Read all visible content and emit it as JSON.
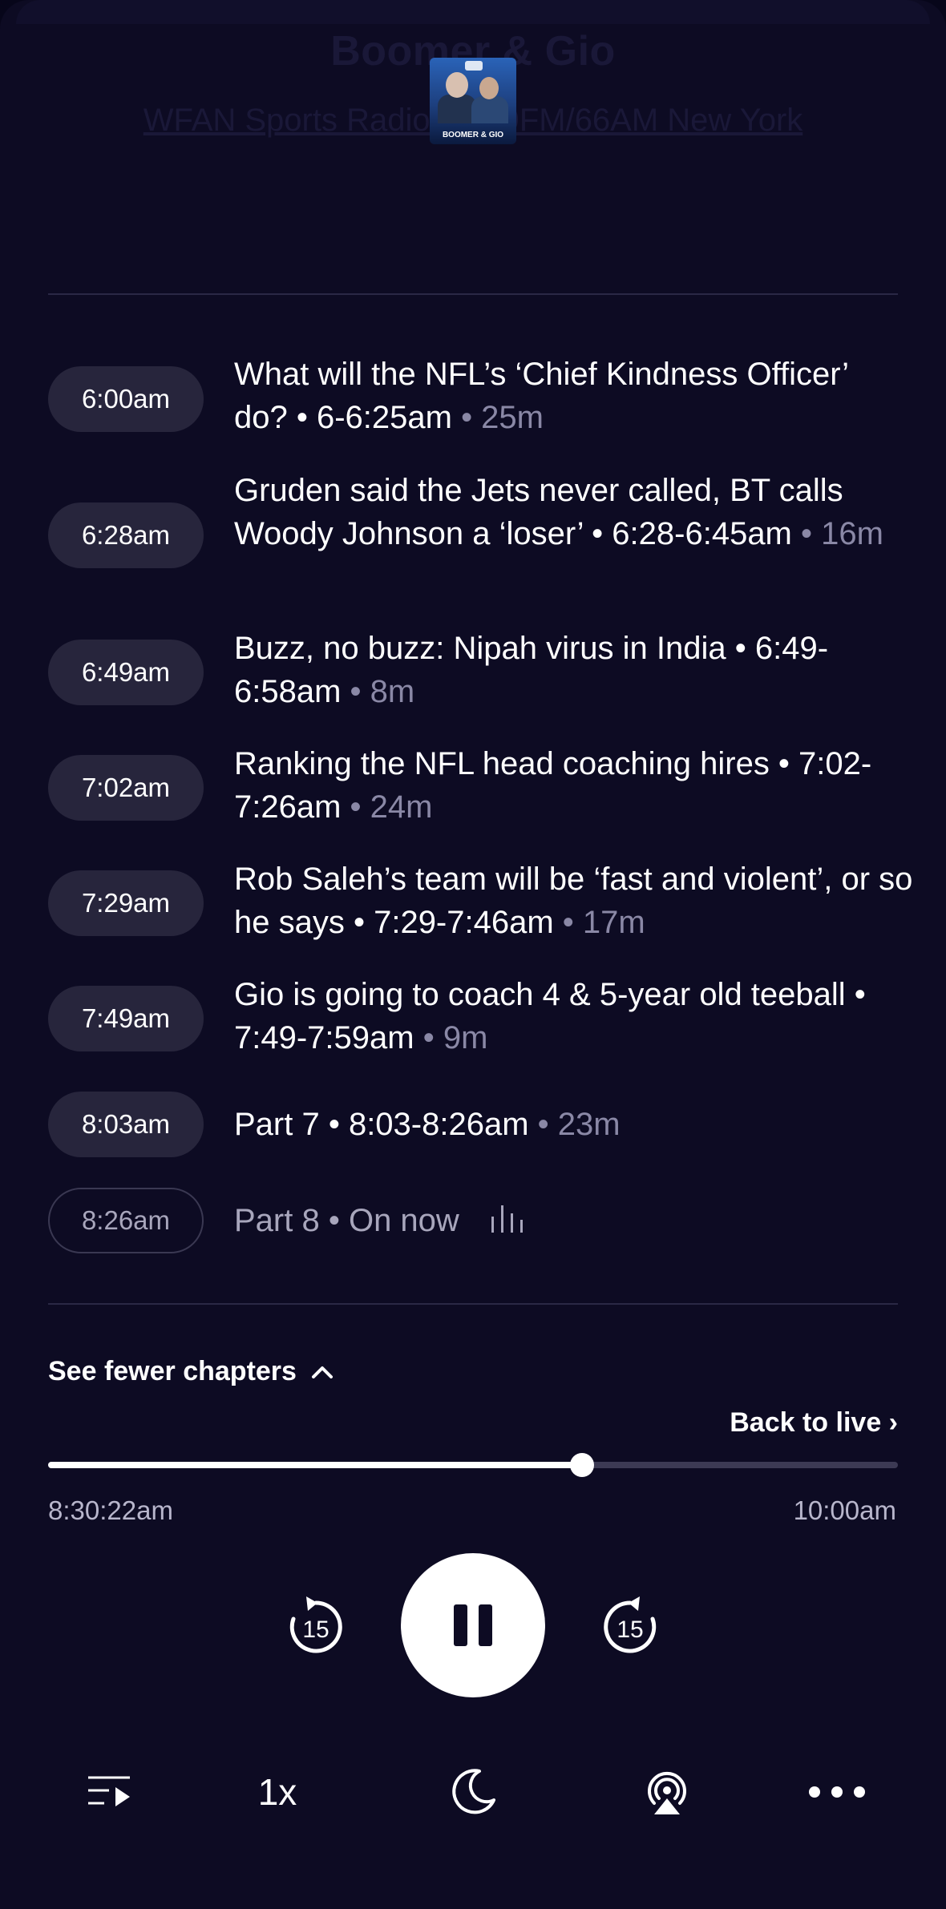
{
  "header": {
    "show_title": "Boomer & Gio",
    "station": "WFAN Sports Radio 101.9FM/66AM New York",
    "artwork_label": "BOOMER & GIO"
  },
  "chapters": [
    {
      "time": "6:00am",
      "title": "What will the NFL’s ‘Chief Kindness Officer’ do? • 6-6:25am",
      "duration": " • 25m"
    },
    {
      "time": "6:28am",
      "title": "Gruden said the Jets never called, BT calls Woody Johnson a ‘loser’ • 6:28-6:45am",
      "duration": " • 16m"
    },
    {
      "time": "6:49am",
      "title": "Buzz, no buzz: Nipah virus in India • 6:49-6:58am",
      "duration": " • 8m"
    },
    {
      "time": "7:02am",
      "title": "Ranking the NFL head coaching hires • 7:02-7:26am",
      "duration": " • 24m"
    },
    {
      "time": "7:29am",
      "title": "Rob Saleh’s team will be ‘fast and violent’, or so he says • 7:29-7:46am",
      "duration": " • 17m"
    },
    {
      "time": "7:49am",
      "title": "Gio is going to coach 4 & 5-year old teeball • 7:49-7:59am",
      "duration": " • 9m"
    },
    {
      "time": "8:03am",
      "title": "Part 7 • 8:03-8:26am",
      "duration": " • 23m"
    },
    {
      "time": "8:26am",
      "title": "Part 8 • On now",
      "duration": ""
    }
  ],
  "see_fewer_label": "See fewer chapters",
  "back_to_live_label": "Back to live ›",
  "progress": {
    "fraction": 0.628,
    "elapsed_label": "8:30:22am",
    "end_label": "10:00am"
  },
  "controls": {
    "rewind_seconds": "15",
    "forward_seconds": "15",
    "speed_label": "1x"
  },
  "colors": {
    "background": "#0d0b23",
    "pill": "#27253c",
    "muted_text": "#8a88a6"
  }
}
